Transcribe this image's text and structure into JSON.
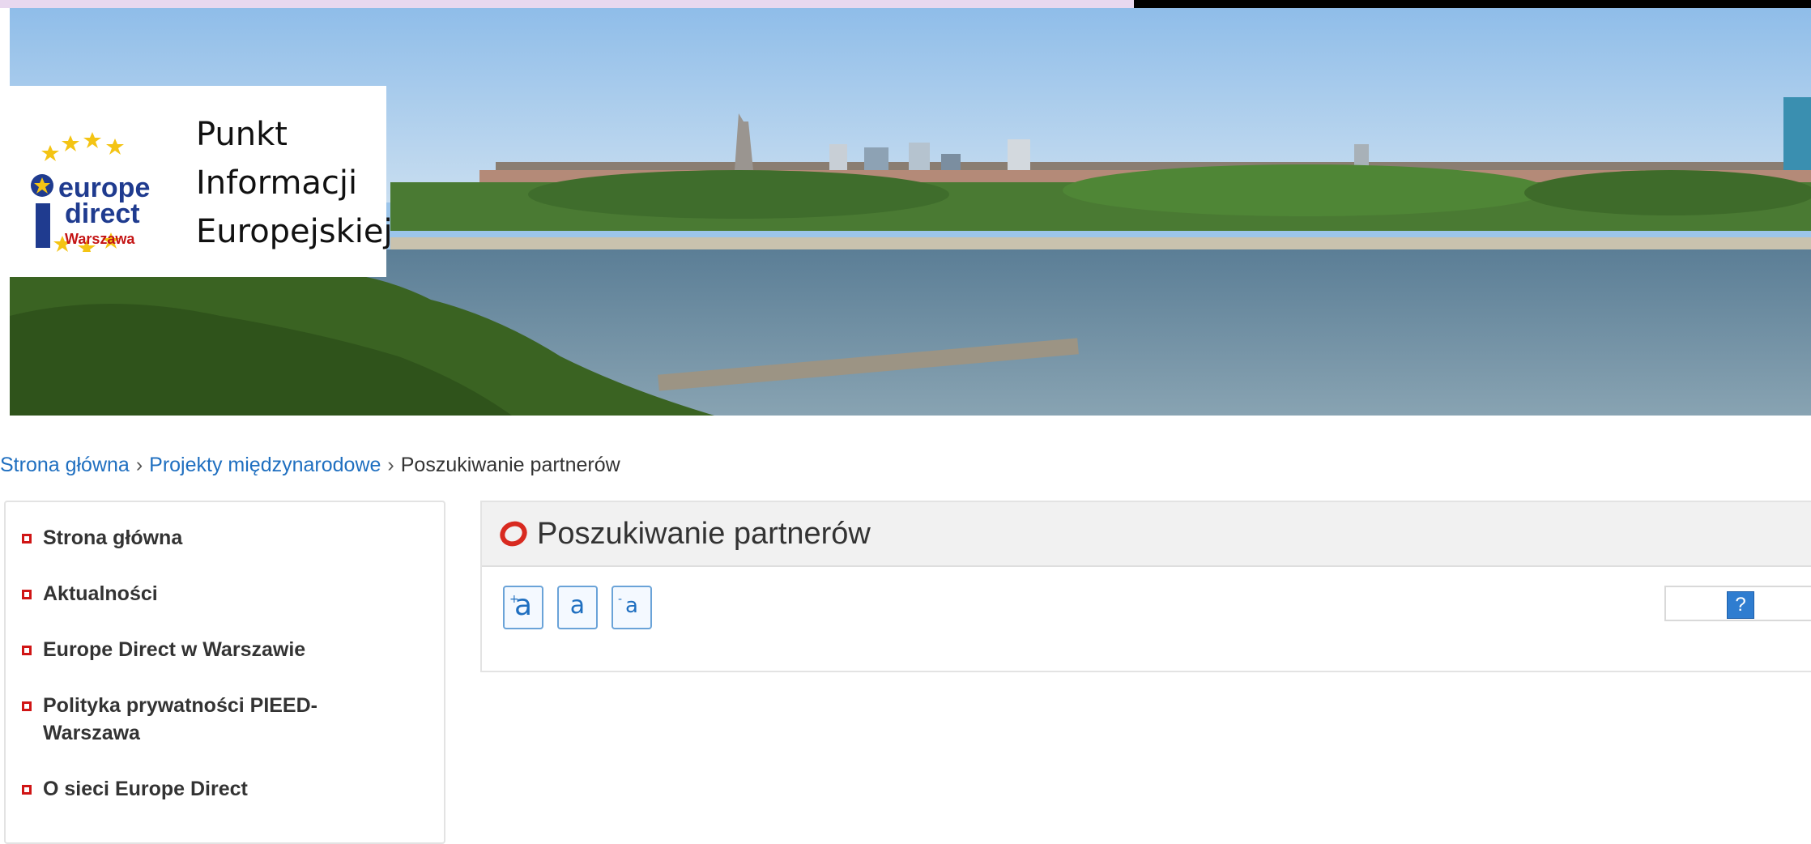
{
  "logo": {
    "emblem_lines": [
      "europe",
      "direct",
      "Warszawa"
    ],
    "title_lines": [
      "Punkt",
      "Informacji",
      "Europejskiej"
    ]
  },
  "breadcrumb": {
    "items": [
      "Strona główna",
      "Projekty międzynarodowe",
      "Poszukiwanie partnerów"
    ],
    "separator": "›"
  },
  "sidebar": {
    "items": [
      {
        "label": "Strona główna"
      },
      {
        "label": "Aktualności"
      },
      {
        "label": "Europe Direct w Warszawie"
      },
      {
        "label": "Polityka prywatności PIEED-Warszawa",
        "lines": [
          "Polityka prywatności PIEED-",
          "Warszawa"
        ]
      },
      {
        "label": "O sieci Europe Direct"
      }
    ]
  },
  "main": {
    "title": "Poszukiwanie partnerów",
    "font_controls": [
      {
        "name": "increase",
        "glyph": "a",
        "mark": "+"
      },
      {
        "name": "normal",
        "glyph": "a",
        "mark": ""
      },
      {
        "name": "decrease",
        "glyph": "a",
        "mark": "-"
      }
    ],
    "help_label": "?"
  },
  "colors": {
    "link": "#1f6fc0",
    "bullet": "#d01515",
    "accent_icon": "#d82a20"
  }
}
